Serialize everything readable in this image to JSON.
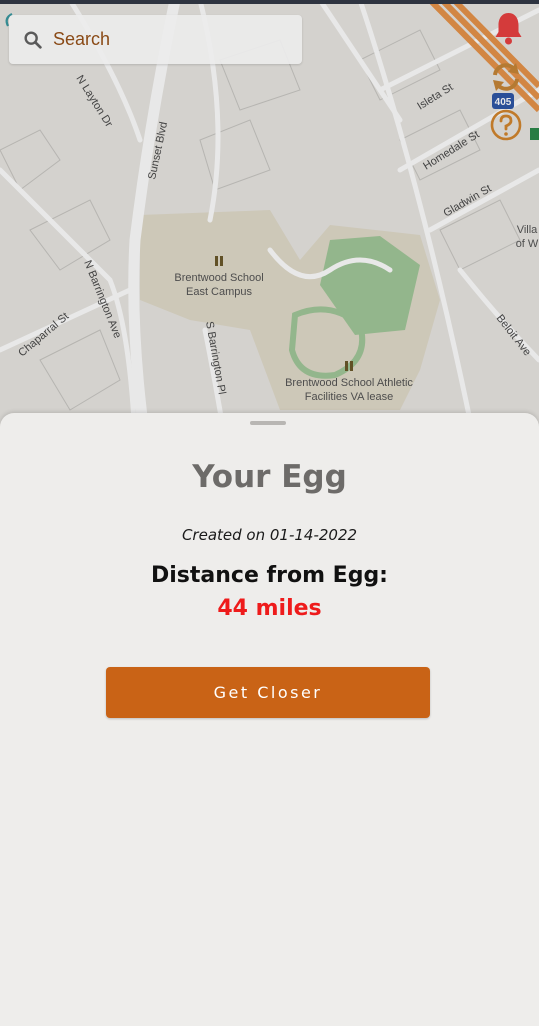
{
  "search": {
    "label": "Search"
  },
  "map": {
    "streets": [
      "N Layton Dr",
      "Sunset Blvd",
      "N Barrington Ave",
      "Chaparral St",
      "S Barrington Pl",
      "Isleta St",
      "Homedale St",
      "Gladwin St",
      "Beloit Ave"
    ],
    "pois": [
      {
        "line1": "Brentwood School",
        "line2": "East Campus"
      },
      {
        "line1": "Brentwood School Athletic",
        "line2": "Facilities VA lease"
      }
    ],
    "edge_label": {
      "line1": "Villa",
      "line2": "of W"
    },
    "highway_shield": "405"
  },
  "icons": {
    "notification": "bell-icon",
    "refresh": "refresh-icon",
    "help": "help-icon",
    "search": "search-icon"
  },
  "sheet": {
    "title": "Your Egg",
    "created": "Created on 01-14-2022",
    "distance_label": "Distance from Egg:",
    "distance_value": "44 miles",
    "button_label": "Get Closer"
  },
  "colors": {
    "accent": "#c96316",
    "distance": "#ee1b1b",
    "bell": "#d43b3b",
    "refresh": "#b57a32",
    "help": "#c07a2a"
  }
}
